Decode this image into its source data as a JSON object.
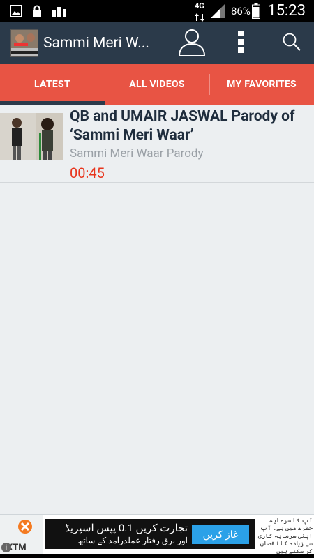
{
  "status_bar": {
    "network": "4G",
    "battery": "86%",
    "time": "15:23"
  },
  "app_bar": {
    "title": "Sammi Meri W..."
  },
  "tabs": [
    {
      "label": "LATEST",
      "selected": true
    },
    {
      "label": "ALL VIDEOS",
      "selected": false
    },
    {
      "label": "MY FAVORITES",
      "selected": false
    }
  ],
  "videos": [
    {
      "title": "QB and UMAIR JASWAL Parody of ‘Sammi Meri Waar’",
      "subtitle": "Sammi Meri Waar Parody",
      "duration": "00:45"
    }
  ],
  "ad": {
    "brand": "XTM",
    "headline_ur": "تجارت کریں 0.1 پپس اسپریڈ",
    "subline_ur": "اور برق رفتار عملدرآمد کے ساتھ",
    "cta_ur": "غاز کریں",
    "side_ur": "آپ کا سرمایہ خطرے میں ہے۔ آپ اپنی سرمایہ کاری سے زیادہ کا نقصان کر سکتے ہیں"
  },
  "colors": {
    "app_bar": "#2b3a4a",
    "tab_bar": "#e85444",
    "accent_duration": "#e8341c"
  }
}
